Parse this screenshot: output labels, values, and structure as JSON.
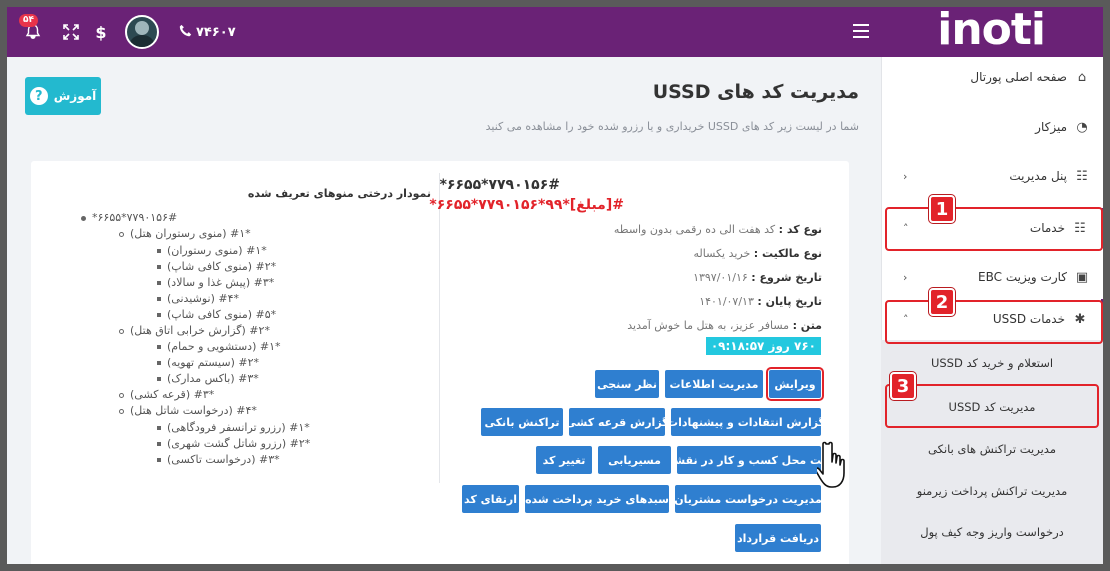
{
  "header": {
    "logo": "inoti",
    "badge_count": "۵۴",
    "phone": "۷۴۶۰۷",
    "dollar": "$"
  },
  "sidebar": {
    "items": [
      {
        "label": "صفحه اصلی پورتال",
        "icon": "home-icon"
      },
      {
        "label": "میزکار",
        "icon": "dashboard-icon"
      },
      {
        "label": "پنل مدیریت",
        "icon": "settings-panel-icon"
      },
      {
        "label": "خدمات",
        "icon": "services-icon"
      },
      {
        "label": "کارت ویزیت EBC",
        "icon": "id-card-icon"
      },
      {
        "label": "خدمات USSD",
        "icon": "puzzle-icon"
      }
    ],
    "sub_items": [
      {
        "label": "استعلام و خرید کد USSD"
      },
      {
        "label": "مدیریت کد USSD"
      },
      {
        "label": "مدیریت تراکنش های بانکی"
      },
      {
        "label": "مدیریت تراکنش پرداخت زیرمنو"
      },
      {
        "label": "درخواست واریز وجه کیف پول"
      }
    ],
    "markers": [
      "1",
      "2",
      "3"
    ]
  },
  "main": {
    "edu_button": "آموزش",
    "title": "مدیریت کد های USSD",
    "subtitle": "شما در لیست زیر کد های USSD خریداری و یا رزرو شده خود را مشاهده می کنید",
    "code_primary": "*۶۶۵۵*۷۷۹۰۱۵۶#",
    "code_secondary": "*۶۶۵۵*۷۷۹۰۱۵۶*۹۹*[مبلغ]#",
    "info": [
      {
        "label": "نوع کد :",
        "value": "کد هفت الی ده رقمی بدون واسطه"
      },
      {
        "label": "نوع مالکیت :",
        "value": "خرید یکساله"
      },
      {
        "label": "تاریخ شروع :",
        "value": "۱۳۹۷/۰۱/۱۶"
      },
      {
        "label": "تاریخ پایان :",
        "value": "۱۴۰۱/۰۷/۱۳"
      },
      {
        "label": "متن :",
        "value": "مسافر عزیز، به هتل ما خوش آمدید"
      }
    ],
    "timer": "۷۶۰ روز ۰۹:۱۸:۵۷",
    "buttons": [
      "ویرایش",
      "مدیریت اطلاعات",
      "نظر سنجی",
      "گزارش انتقادات و پیشنهادات",
      "گزارش قرعه کشی",
      "تراکنش بانکی",
      "ثبت محل کسب و کار در نقشه",
      "مسیریابی",
      "تغییر کد",
      "مدیریت درخواست مشتریان",
      "سبدهای خرید پرداخت شده",
      "ارتقای کد",
      "دریافت قرارداد"
    ],
    "tree_title": "نمودار درختی منوهای تعریف شده",
    "tree": [
      "*۶۶۵۵*۷۷۹۰۱۵۶#",
      "(منوی رستوران هتل) #۱*",
      "(منوی رستوران) #۱*",
      "(منوی کافی شاپ) #۲*",
      "(پیش غذا و سالاد) #۳*",
      "(نوشیدنی) #۴*",
      "(منوی کافی شاپ) #۵*",
      "(گزارش خرابی اتاق هتل) #۲*",
      "(دستشویی و حمام) #۱*",
      "(سیستم تهویه) #۲*",
      "(باکس مدارک) #۳*",
      "(قرعه کشی) #۳*",
      "(درخواست شاتل هتل) #۴*",
      "(رزرو ترانسفر فرودگاهی) #۱*",
      "(رزرو شاتل گشت شهری) #۲*",
      "(درخواست تاکسی) #۳*"
    ]
  },
  "colors": {
    "header": "#6a2276",
    "primary_button": "#2f7fd0",
    "accent_cyan": "#23b9cf",
    "highlight_red": "#e2232a"
  }
}
